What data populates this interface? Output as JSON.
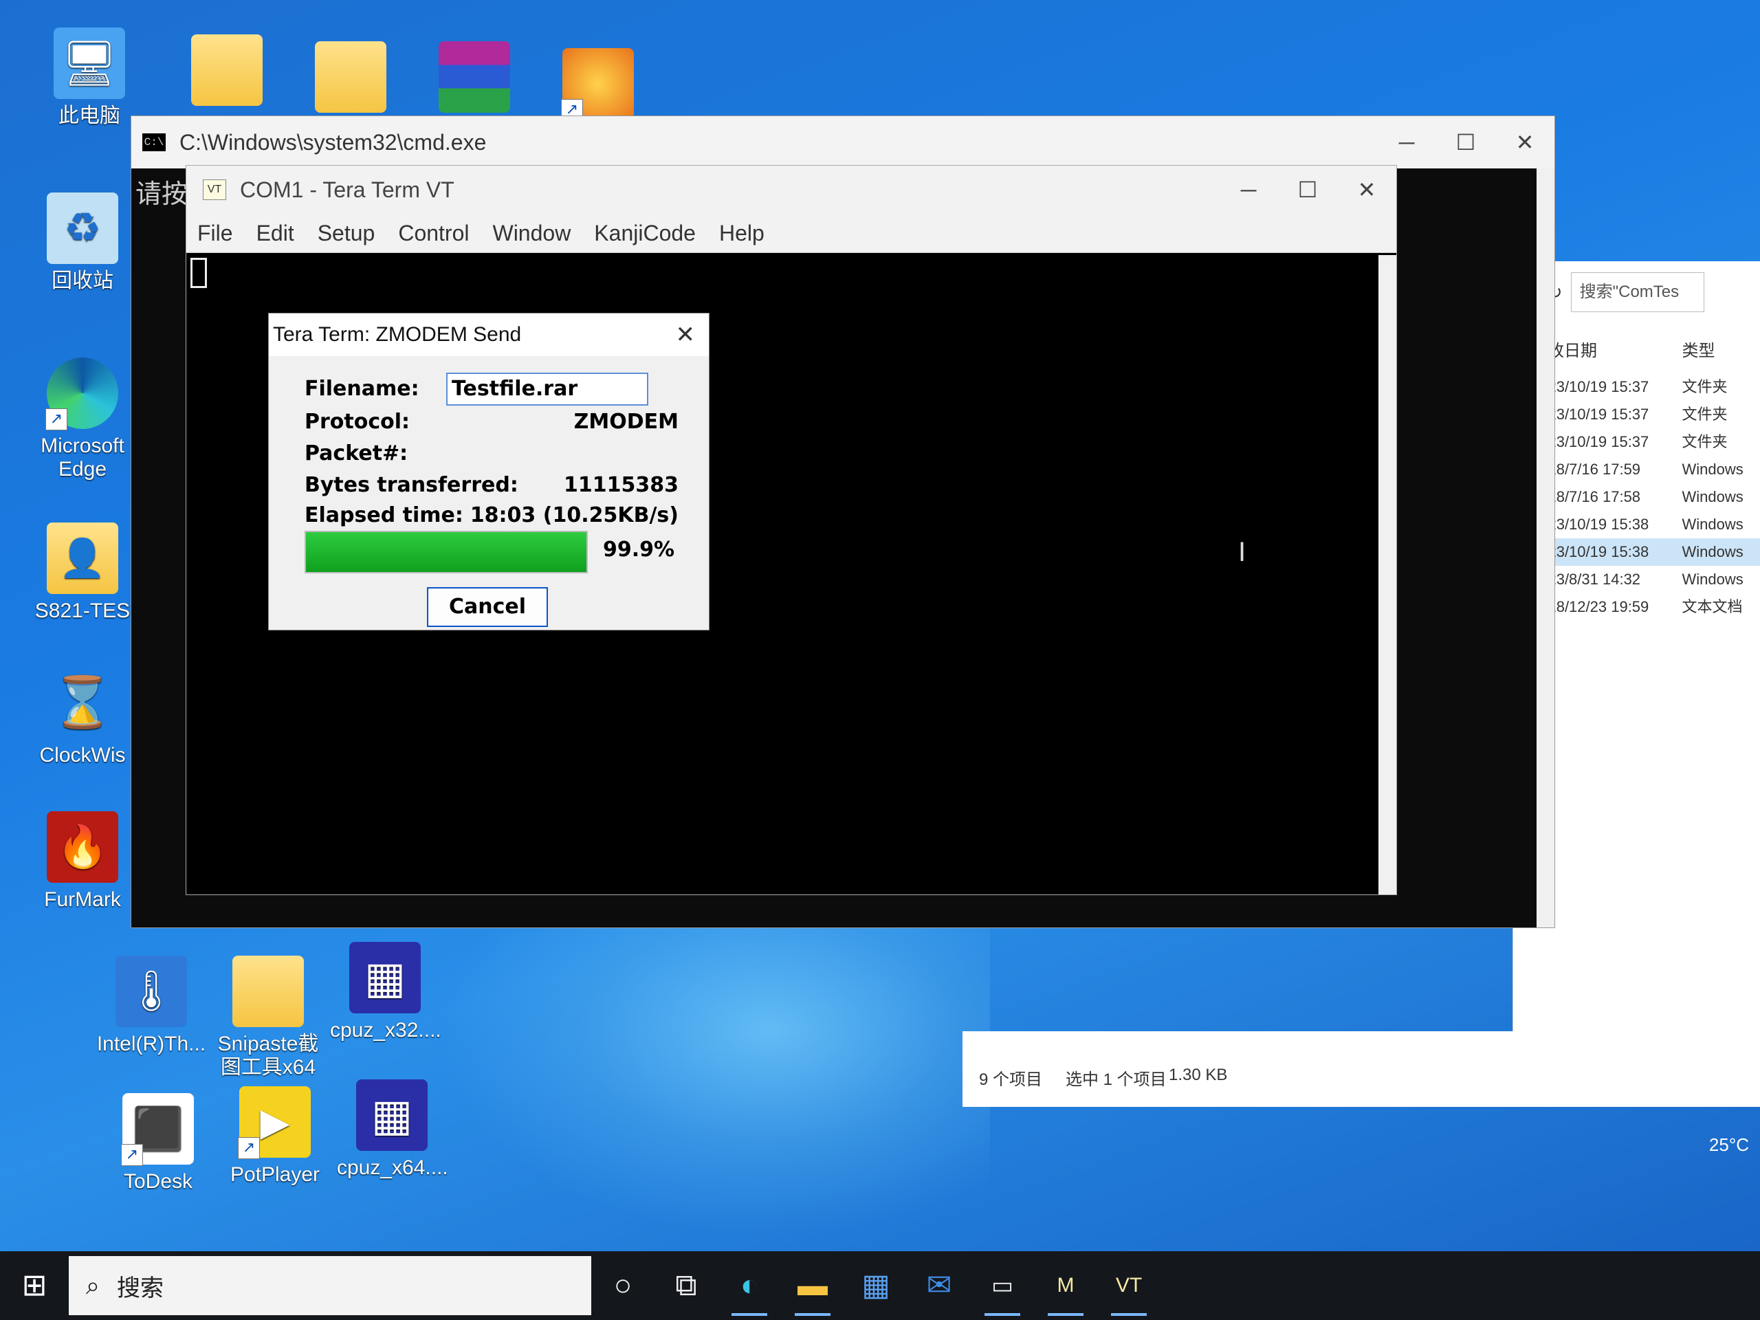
{
  "desktop": {
    "icons": [
      {
        "label": "此电脑",
        "glyph": "🖥"
      },
      {
        "label": "回收站",
        "glyph": "♻"
      },
      {
        "label": "Microsoft Edge",
        "glyph": "◐"
      },
      {
        "label": "S821-TES",
        "glyph": "👤"
      },
      {
        "label": "ClockWis",
        "glyph": "⌛"
      },
      {
        "label": "FurMark",
        "glyph": "🔥"
      },
      {
        "label": "Intel(R)Th...",
        "glyph": "🌡"
      },
      {
        "label": "Snipaste截图工具x64",
        "glyph": "📁"
      },
      {
        "label": "cpuz_x32....",
        "glyph": "▦"
      },
      {
        "label": "ToDesk",
        "glyph": "⬛"
      },
      {
        "label": "PotPlayer",
        "glyph": "▶"
      },
      {
        "label": "cpuz_x64....",
        "glyph": "▦"
      }
    ]
  },
  "cmd_window": {
    "title": "C:\\Windows\\system32\\cmd.exe",
    "text": "请按",
    "icon_text": "C:\\"
  },
  "teraterm": {
    "title": "COM1 - Tera Term VT",
    "icon_text": "VT",
    "menu": [
      "File",
      "Edit",
      "Setup",
      "Control",
      "Window",
      "KanjiCode",
      "Help"
    ]
  },
  "zmodem": {
    "title": "Tera Term: ZMODEM Send",
    "labels": {
      "filename": "Filename:",
      "protocol": "Protocol:",
      "packet": "Packet#:",
      "bytes": "Bytes transferred:",
      "elapsed": "Elapsed time:"
    },
    "values": {
      "filename": "Testfile.rar",
      "protocol": "ZMODEM",
      "packet": "",
      "bytes": "11115383",
      "elapsed": "18:03 (10.25KB/s)"
    },
    "progress_percent": 99.9,
    "progress_text": "99.9%",
    "cancel_label": "Cancel",
    "accent_color": "#0fa01d"
  },
  "explorer": {
    "search_placeholder": "搜索\"ComTes",
    "columns": {
      "date": "修改日期",
      "type": "类型"
    },
    "rows": [
      {
        "date": "2023/10/19 15:37",
        "type": "文件夹"
      },
      {
        "date": "2023/10/19 15:37",
        "type": "文件夹"
      },
      {
        "date": "2023/10/19 15:37",
        "type": "文件夹"
      },
      {
        "date": "2018/7/16 17:59",
        "type": "Windows"
      },
      {
        "date": "2018/7/16 17:58",
        "type": "Windows"
      },
      {
        "date": "2023/10/19 15:38",
        "type": "Windows"
      },
      {
        "date": "2023/10/19 15:38",
        "type": "Windows"
      },
      {
        "date": "2023/8/31 14:32",
        "type": "Windows"
      },
      {
        "date": "2018/12/23 19:59",
        "type": "文本文档"
      }
    ],
    "selected_row": 6,
    "status": {
      "count": "9 个项目",
      "selection": "选中 1 个项目",
      "size": "1.30 KB"
    }
  },
  "taskbar": {
    "search_text": "搜索",
    "apps": [
      "cortana-icon",
      "task-view-icon",
      "edge-icon",
      "explorer-icon",
      "store-icon",
      "mail-icon",
      "terminal-icon",
      "m-app-icon",
      "teraterm-icon"
    ],
    "app_labels": [
      "M",
      "VT"
    ]
  },
  "tray": {
    "temperature": "25°C"
  }
}
